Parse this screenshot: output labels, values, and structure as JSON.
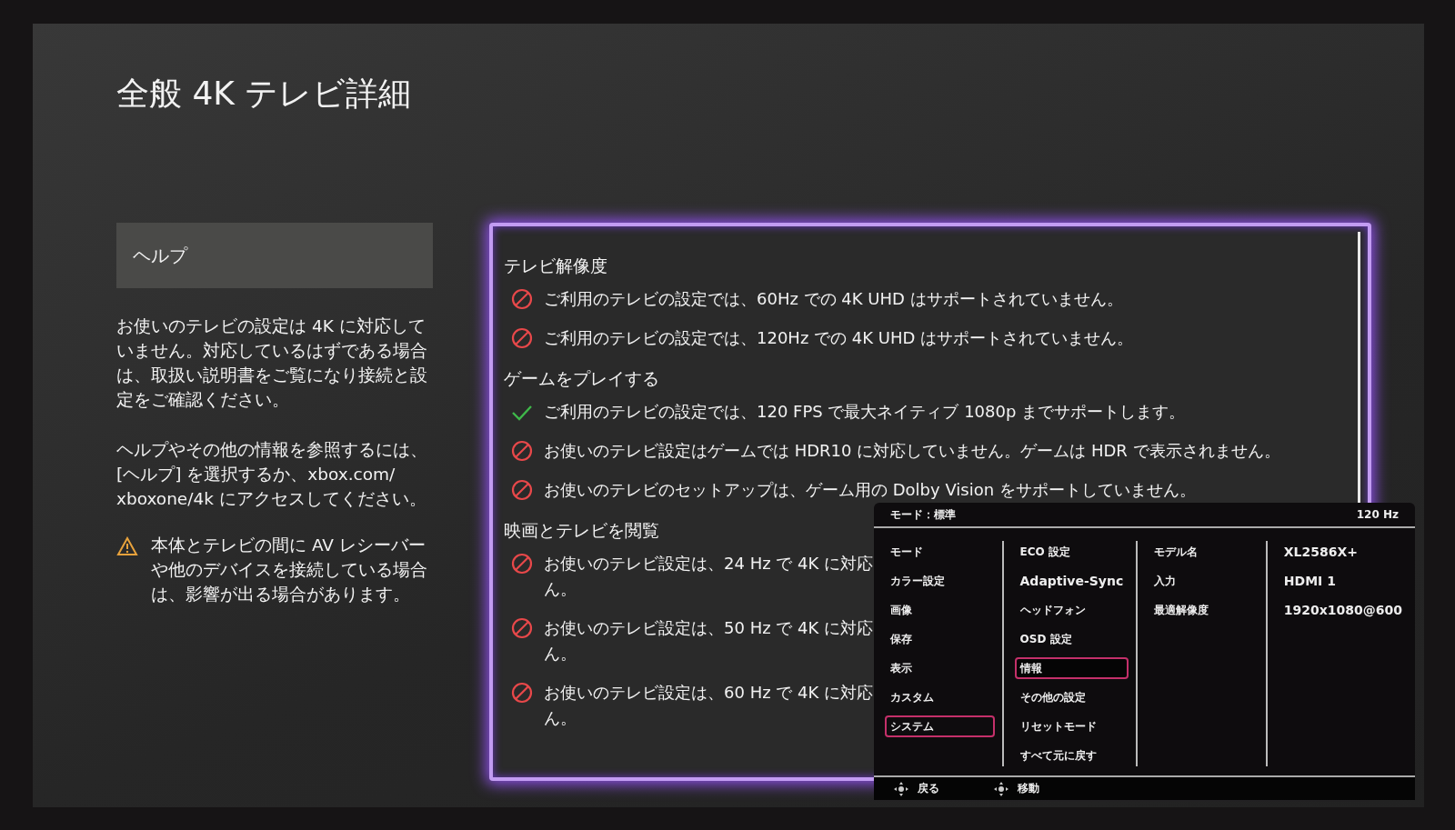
{
  "screen_title": "全般 4K テレビ詳細",
  "help_button": {
    "label": "ヘルプ"
  },
  "description": [
    "お使いのテレビの設定は 4K に対応していません。対応しているはずである場合は、取扱い説明書をご覧になり接続と設定をご確認ください。",
    "ヘルプやその他の情報を参照するには、[ヘルプ] を選択するか、xbox.com/ xboxone/4k にアクセスしてください。"
  ],
  "warning": {
    "text": "本体とテレビの間に AV レシーバーや他のデバイスを接続している場合は、影響が出る場合があります。"
  },
  "details": {
    "sections": [
      {
        "heading": "テレビ解像度",
        "items": [
          {
            "kind": "unsupported",
            "text": "ご利用のテレビの設定では、60Hz での 4K UHD はサポートされていません。"
          },
          {
            "kind": "unsupported",
            "text": "ご利用のテレビの設定では、120Hz での 4K UHD はサポートされていません。"
          }
        ]
      },
      {
        "heading": "ゲームをプレイする",
        "items": [
          {
            "kind": "supported",
            "text": "ご利用のテレビの設定では、120 FPS で最大ネイティブ 1080p までサポートします。"
          },
          {
            "kind": "unsupported",
            "text": "お使いのテレビ設定はゲームでは HDR10 に対応していません。ゲームは HDR で表示されません。"
          },
          {
            "kind": "unsupported",
            "text": "お使いのテレビのセットアップは、ゲーム用の Dolby Vision をサポートしていません。"
          }
        ]
      },
      {
        "heading": "映画とテレビを閲覧",
        "items": [
          {
            "kind": "unsupported",
            "text": "お使いのテレビ設定は、24 Hz で 4K に対応",
            "continuation": "ん。"
          },
          {
            "kind": "unsupported",
            "text": "お使いのテレビ設定は、50 Hz で 4K に対応",
            "continuation": "ん。"
          },
          {
            "kind": "unsupported",
            "text": "お使いのテレビ設定は、60 Hz で 4K に対応",
            "continuation": "ん。"
          }
        ]
      }
    ]
  },
  "osd": {
    "mode": "モード：標準",
    "refresh": "120 Hz",
    "menu": [
      {
        "label": "モード",
        "selected": false
      },
      {
        "label": "カラー設定",
        "selected": false
      },
      {
        "label": "画像",
        "selected": false
      },
      {
        "label": "保存",
        "selected": false
      },
      {
        "label": "表示",
        "selected": false
      },
      {
        "label": "カスタム",
        "selected": false
      },
      {
        "label": "システム",
        "selected": true
      }
    ],
    "submenu": [
      {
        "label": "ECO 設定",
        "selected": false,
        "emphasized": false
      },
      {
        "label": "Adaptive-Sync",
        "selected": false,
        "emphasized": true
      },
      {
        "label": "ヘッドフォン",
        "selected": false,
        "emphasized": false
      },
      {
        "label": "OSD 設定",
        "selected": false,
        "emphasized": false
      },
      {
        "label": "情報",
        "selected": true,
        "emphasized": false
      },
      {
        "label": "その他の設定",
        "selected": false,
        "emphasized": false
      },
      {
        "label": "リセットモード",
        "selected": false,
        "emphasized": false
      },
      {
        "label": "すべて元に戻す",
        "selected": false,
        "emphasized": false
      }
    ],
    "info": [
      {
        "label": "モデル名",
        "value": "XL2586X+"
      },
      {
        "label": "入力",
        "value": "HDMI 1"
      },
      {
        "label": "最適解像度",
        "value": "1920x1080@600"
      }
    ],
    "footer": [
      {
        "label": "戻る"
      },
      {
        "label": "移動"
      }
    ]
  }
}
